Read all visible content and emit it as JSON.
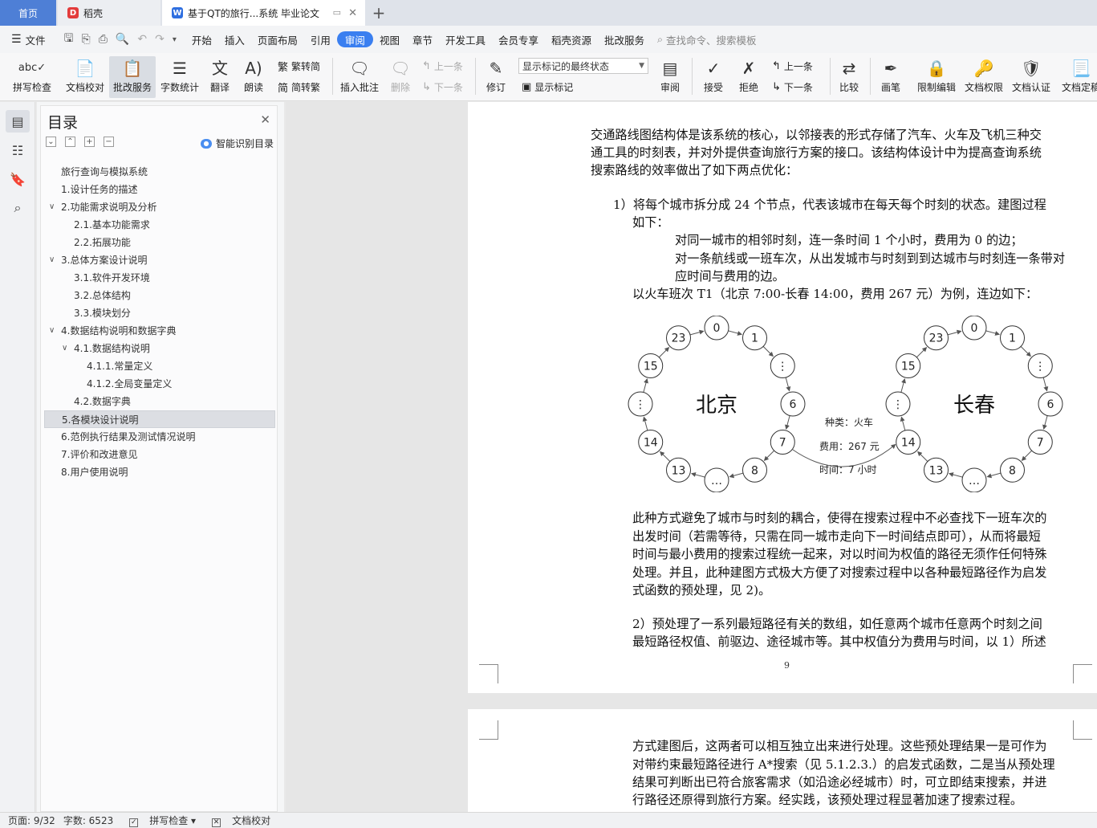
{
  "tabs": {
    "home": "首页",
    "daoke": "稻壳",
    "doc": "基于QT的旅行...系统 毕业论文"
  },
  "menu": {
    "file": "文件",
    "items": [
      "开始",
      "插入",
      "页面布局",
      "引用",
      "审阅",
      "视图",
      "章节",
      "开发工具",
      "会员专享",
      "稻壳资源",
      "批改服务"
    ],
    "active": "审阅",
    "search": "查找命令、搜索模板"
  },
  "ribbon": {
    "spell": "拼写检查",
    "proof": "文档校对",
    "correct": "批改服务",
    "wordcount": "字数统计",
    "translate": "翻译",
    "read": "朗读",
    "trad": "繁转简",
    "simp": "简转繁",
    "insert_comment": "插入批注",
    "delete": "删除",
    "prev": "上一条",
    "next": "下一条",
    "revise": "修订",
    "markup_state": "显示标记的最终状态",
    "show_markup": "显示标记",
    "review": "审阅",
    "accept": "接受",
    "reject": "拒绝",
    "prev2": "上一条",
    "next2": "下一条",
    "compare": "比较",
    "pen": "画笔",
    "restrict": "限制编辑",
    "perm": "文档权限",
    "cert": "文档认证",
    "final": "文档定稿"
  },
  "toc": {
    "title": "目录",
    "smart": "智能识别目录",
    "items": [
      {
        "text": "旅行查询与模拟系统",
        "level": 0,
        "chev": ""
      },
      {
        "text": "1.设计任务的描述",
        "level": 0,
        "chev": ""
      },
      {
        "text": "2.功能需求说明及分析",
        "level": 0,
        "chev": "v"
      },
      {
        "text": "2.1.基本功能需求",
        "level": 1,
        "chev": ""
      },
      {
        "text": "2.2.拓展功能",
        "level": 1,
        "chev": ""
      },
      {
        "text": "3.总体方案设计说明",
        "level": 0,
        "chev": "v"
      },
      {
        "text": "3.1.软件开发环境",
        "level": 1,
        "chev": ""
      },
      {
        "text": "3.2.总体结构",
        "level": 1,
        "chev": ""
      },
      {
        "text": "3.3.模块划分",
        "level": 1,
        "chev": ""
      },
      {
        "text": "4.数据结构说明和数据字典",
        "level": 0,
        "chev": "v"
      },
      {
        "text": "4.1.数据结构说明",
        "level": 1,
        "chev": "v"
      },
      {
        "text": "4.1.1.常量定义",
        "level": 2,
        "chev": ""
      },
      {
        "text": "4.1.2.全局变量定义",
        "level": 2,
        "chev": ""
      },
      {
        "text": "4.2.数据字典",
        "level": 1,
        "chev": ""
      },
      {
        "text": "5.各模块设计说明",
        "level": 0,
        "chev": "",
        "selected": true
      },
      {
        "text": "6.范例执行结果及测试情况说明",
        "level": 0,
        "chev": ""
      },
      {
        "text": "7.评价和改进意见",
        "level": 0,
        "chev": ""
      },
      {
        "text": "8.用户使用说明",
        "level": 0,
        "chev": ""
      }
    ]
  },
  "doc": {
    "p1": [
      "交通路线图结构体是该系统的核心，以邻接表的形式存储了汽车、火车及飞机三种交",
      "通工具的时刻表，并对外提供查询旅行方案的接口。该结构体设计中为提高查询系统",
      "搜索路线的效率做出了如下两点优化："
    ],
    "p2": [
      "1）将每个城市拆分成 24 个节点，代表该城市在每天每个时刻的状态。建图过程",
      "如下："
    ],
    "p3": [
      "对同一城市的相邻时刻，连一条时间 1 个小时，费用为 0 的边；",
      "对一条航线或一班车次，从出发城市与时刻到到达城市与时刻连一条带对",
      "应时间与费用的边。"
    ],
    "p4": "以火车班次 T1（北京 7:00-长春 14:00，费用 267 元）为例，连边如下：",
    "p5": [
      "此种方式避免了城市与时刻的耦合，使得在搜索过程中不必查找下一班车次的",
      "出发时间（若需等待，只需在同一城市走向下一时间结点即可），从而将最短",
      "时间与最小费用的搜索过程统一起来，对以时间为权值的路径无须作任何特殊",
      "处理。并且，此种建图方式极大方便了对搜索过程中以各种最短路径作为启发",
      "式函数的预处理，见 2)。"
    ],
    "p6": [
      "2）预处理了一系列最短路径有关的数组，如任意两个城市任意两个时刻之间",
      "最短路径权值、前驱边、途径城市等。其中权值分为费用与时间，以 1）所述"
    ],
    "page_num": "9",
    "p7": [
      "方式建图后，这两者可以相互独立出来进行处理。这些预处理结果一是可作为",
      "对带约束最短路径进行 A*搜索（见 5.1.2.3.）的启发式函数，二是当从预处理",
      "结果可判断出已符合旅客需求（如沿途必经城市）时，可立即结束搜索，并进",
      "行路径还原得到旅行方案。经实践，该预处理过程显著加速了搜索过程。"
    ]
  },
  "figure": {
    "left_city": "北京",
    "right_city": "长春",
    "nodes": [
      "0",
      "1",
      "⋮",
      "6",
      "7",
      "8",
      "…",
      "13",
      "14",
      "⋮",
      "15",
      "23"
    ],
    "edge_type": "种类：火车",
    "edge_cost": "费用：267 元",
    "edge_time": "时间：7 小时"
  },
  "status": {
    "page": "页面: 9/32",
    "words": "字数: 6523",
    "spell": "拼写检查",
    "proof": "文档校对"
  }
}
